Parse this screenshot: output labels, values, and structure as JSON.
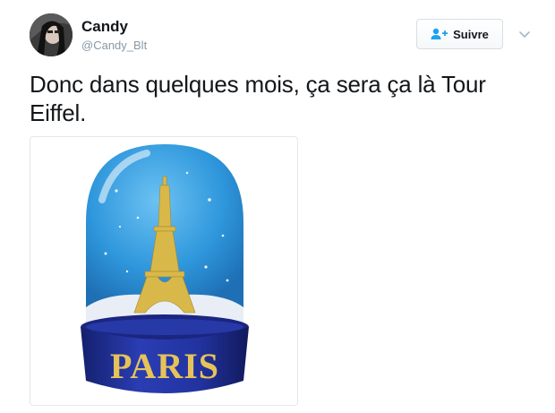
{
  "user": {
    "name": "Candy",
    "handle": "@Candy_Blt"
  },
  "follow_button": {
    "label": "Suivre",
    "accent": "#1da1f2"
  },
  "tweet": {
    "text": "Donc dans quelques mois, ça sera ça là Tour Eiffel."
  },
  "media": {
    "base_text": "PARIS",
    "globe_color": "#3a9ee0",
    "base_color": "#1f2d9a",
    "tower_color": "#d9b84a"
  },
  "icons": {
    "follow": "add-user-icon",
    "more": "chevron-down-icon"
  }
}
